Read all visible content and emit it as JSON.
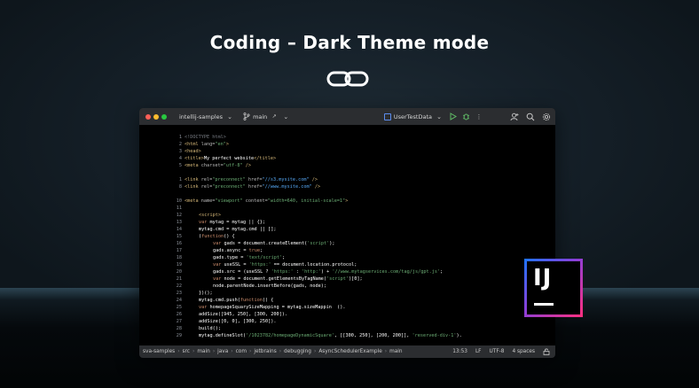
{
  "headline": "Coding – Dark Theme mode",
  "icons": {
    "link": "link-icon",
    "branch": "git-branch-icon",
    "run": "run-icon",
    "debug": "debug-icon",
    "more": "more-icon",
    "profile": "profile-icon",
    "search": "search-icon",
    "settings": "gear-icon"
  },
  "ide": {
    "window_controls": [
      "#ff5f57",
      "#febc2e",
      "#28c840"
    ],
    "project": "intellij-samples",
    "branch": "main",
    "run_config": "UserTestData",
    "colors": {
      "titlebar": "#2b2d30",
      "editor_bg": "#000000",
      "tag": "#d5b778",
      "string": "#6aab73",
      "keyword": "#cf8e6d",
      "url": "#56a8f5"
    }
  },
  "editor": {
    "lines": [
      {
        "n": "1",
        "segments": [
          {
            "t": "<!DOCTYPE html>",
            "c": "cm"
          }
        ]
      },
      {
        "n": "2",
        "segments": [
          {
            "t": "<html ",
            "c": "tag"
          },
          {
            "t": "lang=",
            "c": "attr"
          },
          {
            "t": "\"en\"",
            "c": "str"
          },
          {
            "t": ">",
            "c": "tag"
          }
        ]
      },
      {
        "n": "3",
        "segments": [
          {
            "t": "<head>",
            "c": "tag"
          }
        ]
      },
      {
        "n": "4",
        "segments": [
          {
            "t": "<title>",
            "c": "tag"
          },
          {
            "t": "My perfect website",
            "c": ""
          },
          {
            "t": "</title>",
            "c": "tag"
          }
        ]
      },
      {
        "n": "5",
        "segments": [
          {
            "t": "<meta ",
            "c": "tag"
          },
          {
            "t": "charset=",
            "c": "attr"
          },
          {
            "t": "\"utf-8\"",
            "c": "str"
          },
          {
            "t": " />",
            "c": "tag"
          }
        ]
      },
      {
        "n": "",
        "segments": []
      },
      {
        "n": "1",
        "segments": [
          {
            "t": "<link ",
            "c": "tag"
          },
          {
            "t": "rel=",
            "c": "attr"
          },
          {
            "t": "\"preconnect\" ",
            "c": "str"
          },
          {
            "t": "href=",
            "c": "attr"
          },
          {
            "t": "\"//s3.mysite.com\"",
            "c": "url"
          },
          {
            "t": " />",
            "c": "tag"
          }
        ]
      },
      {
        "n": "8",
        "segments": [
          {
            "t": "<link ",
            "c": "tag"
          },
          {
            "t": "rel=",
            "c": "attr"
          },
          {
            "t": "\"preconnect\" ",
            "c": "str"
          },
          {
            "t": "href=",
            "c": "attr"
          },
          {
            "t": "\"//www.mysite.com\"",
            "c": "url"
          },
          {
            "t": " />",
            "c": "tag"
          }
        ]
      },
      {
        "n": "",
        "segments": []
      },
      {
        "n": "10",
        "segments": [
          {
            "t": "<meta ",
            "c": "tag"
          },
          {
            "t": "name=",
            "c": "attr"
          },
          {
            "t": "\"viewport\" ",
            "c": "str"
          },
          {
            "t": "content=",
            "c": "attr"
          },
          {
            "t": "\"width=640, initial-scale=1\"",
            "c": "str"
          },
          {
            "t": ">",
            "c": "tag"
          }
        ]
      },
      {
        "n": "11",
        "segments": []
      },
      {
        "n": "12",
        "indent": 1,
        "segments": [
          {
            "t": "<script>",
            "c": "tag"
          }
        ]
      },
      {
        "n": "13",
        "indent": 1,
        "segments": [
          {
            "t": "var ",
            "c": "kw"
          },
          {
            "t": "mytag = mytag || {};",
            "c": ""
          }
        ]
      },
      {
        "n": "14",
        "indent": 1,
        "segments": [
          {
            "t": "mytag.cmd = mytag.cmd || [];",
            "c": ""
          }
        ]
      },
      {
        "n": "15",
        "indent": 1,
        "segments": [
          {
            "t": "(",
            "c": ""
          },
          {
            "t": "function",
            "c": "kw"
          },
          {
            "t": "() {",
            "c": ""
          }
        ]
      },
      {
        "n": "16",
        "indent": 2,
        "segments": [
          {
            "t": "var ",
            "c": "kw"
          },
          {
            "t": "gads = document.createElement(",
            "c": ""
          },
          {
            "t": "'script'",
            "c": "str"
          },
          {
            "t": ");",
            "c": ""
          }
        ]
      },
      {
        "n": "17",
        "indent": 2,
        "segments": [
          {
            "t": "gads.async = ",
            "c": ""
          },
          {
            "t": "true",
            "c": "kw"
          },
          {
            "t": ";",
            "c": ""
          }
        ]
      },
      {
        "n": "18",
        "indent": 2,
        "segments": [
          {
            "t": "gads.type = ",
            "c": ""
          },
          {
            "t": "'text/script'",
            "c": "str"
          },
          {
            "t": ";",
            "c": ""
          }
        ]
      },
      {
        "n": "19",
        "indent": 2,
        "segments": [
          {
            "t": "var ",
            "c": "kw"
          },
          {
            "t": "useSSL = ",
            "c": ""
          },
          {
            "t": "'https:'",
            "c": "str"
          },
          {
            "t": " == document.location.protocol;",
            "c": ""
          }
        ]
      },
      {
        "n": "20",
        "indent": 2,
        "segments": [
          {
            "t": "gads.src = (useSSL ? ",
            "c": ""
          },
          {
            "t": "'https:'",
            "c": "str"
          },
          {
            "t": " : ",
            "c": ""
          },
          {
            "t": "'http:'",
            "c": "str"
          },
          {
            "t": ") + ",
            "c": ""
          },
          {
            "t": "'//www.mytagservices.com/tag/js/gpt.js'",
            "c": "str"
          },
          {
            "t": ";",
            "c": ""
          }
        ]
      },
      {
        "n": "21",
        "indent": 2,
        "segments": [
          {
            "t": "var ",
            "c": "kw"
          },
          {
            "t": "node = document.getElementsByTagName(",
            "c": ""
          },
          {
            "t": "'script'",
            "c": "str"
          },
          {
            "t": ")[0];",
            "c": ""
          }
        ]
      },
      {
        "n": "22",
        "indent": 2,
        "segments": [
          {
            "t": "node.parentNode.insertBefore(gads, node);",
            "c": ""
          }
        ]
      },
      {
        "n": "23",
        "indent": 1,
        "segments": [
          {
            "t": "})();",
            "c": ""
          }
        ]
      },
      {
        "n": "24",
        "indent": 1,
        "segments": [
          {
            "t": "mytag.cmd.push(",
            "c": ""
          },
          {
            "t": "function",
            "c": "kw"
          },
          {
            "t": "() {",
            "c": ""
          }
        ]
      },
      {
        "n": "25",
        "indent": 1,
        "segments": [
          {
            "t": "var ",
            "c": "kw"
          },
          {
            "t": "homepageSquarySizeMapping = mytag.sizeMappin  ().",
            "c": ""
          }
        ]
      },
      {
        "n": "26",
        "indent": 1,
        "segments": [
          {
            "t": "addSize([945, 250], [300, 200]).",
            "c": ""
          }
        ]
      },
      {
        "n": "27",
        "indent": 1,
        "segments": [
          {
            "t": "addSize([0, 0], [300, 250]).",
            "c": ""
          }
        ]
      },
      {
        "n": "28",
        "indent": 1,
        "segments": [
          {
            "t": "build();",
            "c": ""
          }
        ]
      },
      {
        "n": "29",
        "indent": 1,
        "segments": [
          {
            "t": "mytag.defineSlot(",
            "c": ""
          },
          {
            "t": "'/1023782/homepageDynamicSquare'",
            "c": "str"
          },
          {
            "t": ", [[300, 250], [200, 200]], ",
            "c": ""
          },
          {
            "t": "'reserved-div-1'",
            "c": "str"
          },
          {
            "t": ").",
            "c": ""
          }
        ]
      }
    ]
  },
  "statusbar": {
    "breadcrumbs": [
      "sva-samples",
      "src",
      "main",
      "java",
      "com",
      "jetbrains",
      "debugging",
      "AsyncSchedulerExample",
      "main"
    ],
    "position": "13:53",
    "line_sep": "LF",
    "encoding": "UTF-8",
    "indent": "4 spaces"
  },
  "logo": {
    "text": "IJ"
  }
}
